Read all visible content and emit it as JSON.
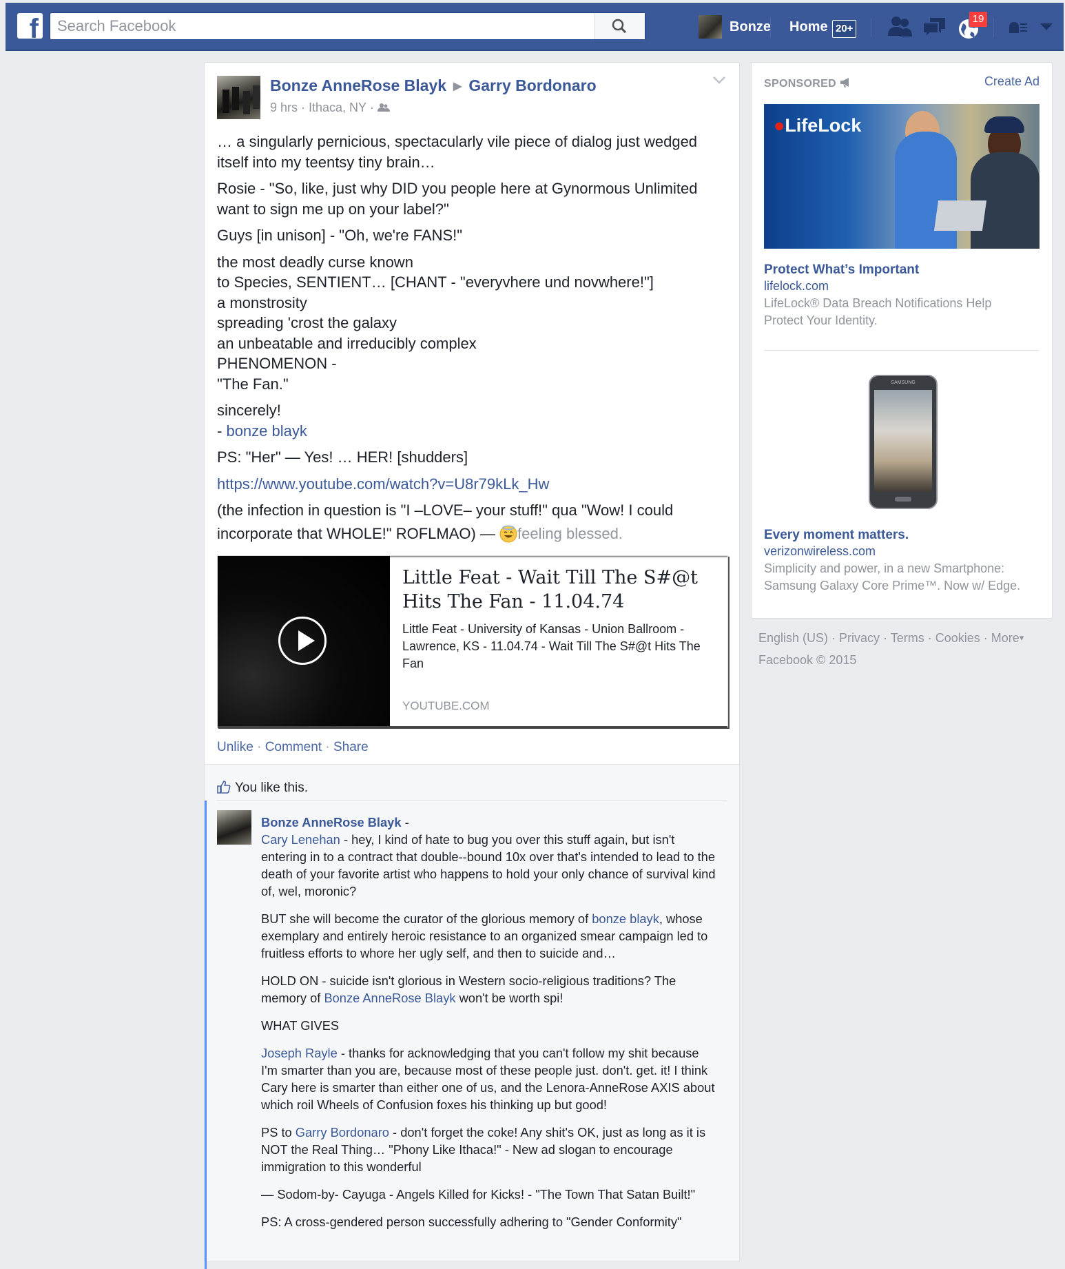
{
  "topbar": {
    "search_placeholder": "Search Facebook",
    "profile_name": "Bonze",
    "home_label": "Home",
    "home_badge": "20+",
    "notifications_count": "19"
  },
  "post": {
    "author": "Bonze AnneRose Blayk",
    "target": "Garry Bordonaro",
    "meta": "9 hrs · Ithaca, NY ·",
    "p1": "… a singularly pernicious, spectacularly vile piece of dialog just wedged itself into my teentsy tiny brain…",
    "p2": "Rosie - \"So, like, just why DID you people here at Gynormous Unlimited want to sign me up on your label?\"",
    "p3": "Guys [in unison] - \"Oh, we're FANS!\"",
    "poem": [
      "the most deadly curse known",
      "to Species, SENTIENT… [CHANT - \"everyvhere und novwhere!\"]",
      "a monstrosity",
      "spreading 'crost the galaxy",
      "an unbeatable and irreducibly complex",
      "PHENOMENON -",
      "\"The Fan.\""
    ],
    "sincerely": "sincerely!",
    "sig_prefix": "- ",
    "sig_link": "bonze blayk",
    "ps": "PS: \"Her\" — Yes! … HER! [shudders]",
    "url": "https://www.youtube.com/watch?v=U8r79kLk_Hw",
    "last_text": "(the infection in question is \"I –LOVE– your stuff!\" qua \"Wow! I could incorporate that WHOLE!\" ROFLMAO) — ",
    "feeling": "feeling blessed.",
    "link_card": {
      "title": "Little Feat - Wait Till The S#@t Hits The Fan - 11.04.74",
      "description": "Little Feat - University of Kansas - Union Ballroom - Lawrence, KS - 11.04.74 - Wait Till The S#@t Hits The Fan",
      "domain": "YOUTUBE.COM"
    },
    "actions": {
      "unlike": "Unlike",
      "comment": "Comment",
      "share": "Share",
      "sep": " · "
    },
    "likes_text": "You like this."
  },
  "comment": {
    "author": "Bonze AnneRose Blayk",
    "author_suffix": " -",
    "p1_link": "Cary Lenehan",
    "p1_text": " - hey, I kind of hate to bug you over this stuff again, but isn't entering in to a contract that double--bound 10x over that's intended to lead to the death of your favorite artist who happens to hold your only chance of survival kind of, wel, moronic?",
    "p2_pre": "BUT she will become the curator of the glorious memory of ",
    "p2_link": "bonze blayk",
    "p2_post": ", whose exemplary and entirely heroic resistance to an organized smear campaign led to fruitless efforts to whore her ugly self, and then to suicide and…",
    "p3_pre": "HOLD ON - suicide isn't glorious in Western socio-religious traditions? The memory of ",
    "p3_link": "Bonze AnneRose Blayk",
    "p3_post": " won't be worth spi!",
    "p4": "WHAT GIVES",
    "p5_link": "Joseph Rayle",
    "p5_text": " - thanks for acknowledging that you can't follow my shit because I'm smarter than you are, because most of these people just. don't. get. it! I think Cary here is smarter than either one of us, and the Lenora-AnneRose AXIS about which roil Wheels of Confusion foxes his thinking up but good!",
    "p6_pre": "PS to ",
    "p6_link": "Garry Bordonaro",
    "p6_post": " - don't forget the coke! Any shit's OK, just as long as it is NOT the Real Thing… \"Phony Like Ithaca!\" - New ad slogan to encourage immigration to this wonderful",
    "p7": "— Sodom-by- Cayuga - Angels Killed for Kicks! - \"The Town That Satan Built!\"",
    "p8": "PS: A cross-gendered person successfully adhering to \"Gender Conformity\""
  },
  "sidebar": {
    "sponsored": "SPONSORED",
    "create_ad": "Create Ad",
    "ad1": {
      "logo": "LifeLock",
      "title": "Protect What’s Important",
      "domain": "lifelock.com",
      "description": "LifeLock® Data Breach Notifications Help Protect Your Identity."
    },
    "ad2": {
      "phone_brand": "SAMSUNG",
      "title": "Every moment matters.",
      "domain": "verizonwireless.com",
      "description": "Simplicity and power, in a new Smartphone: Samsung Galaxy Core Prime™. Now w/ Edge."
    }
  },
  "footer": {
    "links": "English (US) · Privacy · Terms · Cookies · More",
    "more_caret": "▾",
    "copyright": "Facebook © 2015"
  }
}
